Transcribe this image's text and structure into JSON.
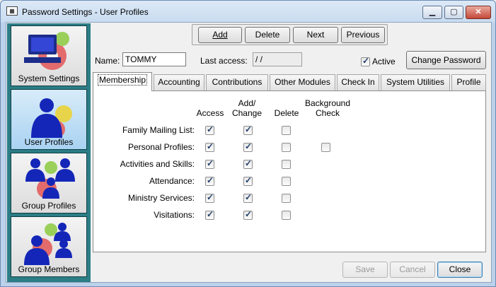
{
  "window": {
    "title": "Password Settings - User Profiles",
    "icon": "app-icon"
  },
  "sidebar": {
    "items": [
      {
        "label": "System Settings",
        "icon": "computer-gear-icon"
      },
      {
        "label": "User Profiles",
        "icon": "user-icon",
        "active": true
      },
      {
        "label": "Group Profiles",
        "icon": "group-icon"
      },
      {
        "label": "Group Members",
        "icon": "group-members-icon"
      }
    ]
  },
  "toolbar": {
    "add": "Add",
    "delete": "Delete",
    "next": "Next",
    "previous": "Previous"
  },
  "form": {
    "name_label": "Name:",
    "name_value": "TOMMY",
    "last_access_label": "Last access:",
    "last_access_value": " / /",
    "active_label": "Active",
    "active_checked": true,
    "change_password": "Change Password"
  },
  "tabs": [
    "Membership",
    "Accounting",
    "Contributions",
    "Other Modules",
    "Check In",
    "System Utilities",
    "Profile"
  ],
  "membership": {
    "columns": {
      "access": "Access",
      "add_change_1": "Add/",
      "add_change_2": "Change",
      "delete": "Delete",
      "bg_1": "Background",
      "bg_2": "Check"
    },
    "rows": [
      {
        "label": "Family Mailing List:",
        "access": true,
        "add_change": true,
        "delete": false,
        "background": null
      },
      {
        "label": "Personal Profiles:",
        "access": true,
        "add_change": true,
        "delete": false,
        "background": false
      },
      {
        "label": "Activities and Skills:",
        "access": true,
        "add_change": true,
        "delete": false,
        "background": null
      },
      {
        "label": "Attendance:",
        "access": true,
        "add_change": true,
        "delete": false,
        "background": null
      },
      {
        "label": "Ministry Services:",
        "access": true,
        "add_change": true,
        "delete": false,
        "background": null
      },
      {
        "label": "Visitations:",
        "access": true,
        "add_change": true,
        "delete": false,
        "background": null
      }
    ]
  },
  "footer": {
    "save": "Save",
    "cancel": "Cancel",
    "close": "Close"
  },
  "colors": {
    "sidebar": "#2c7d86",
    "titlebar": "#c9dcf0",
    "accent": "#1f3d6a"
  }
}
